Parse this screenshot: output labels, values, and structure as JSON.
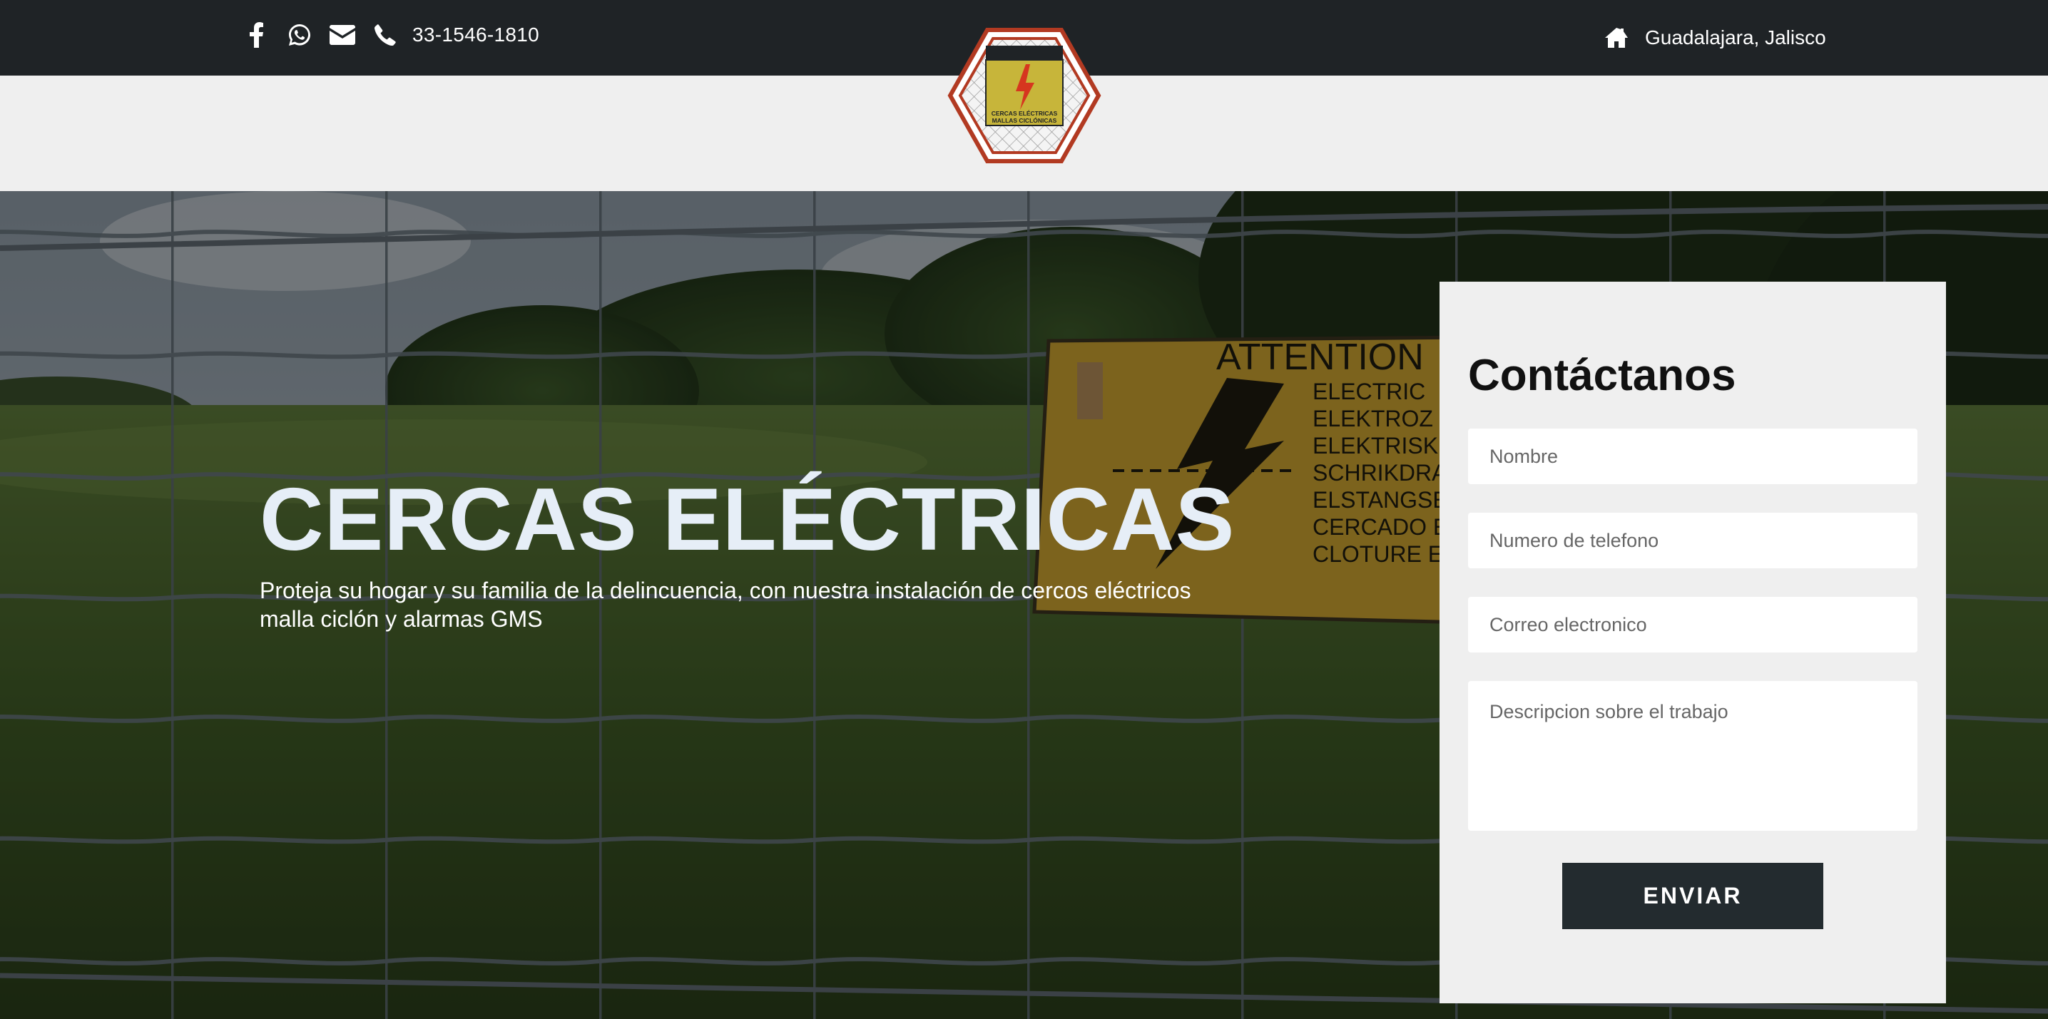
{
  "topbar": {
    "icons": [
      "facebook-icon",
      "whatsapp-icon",
      "envelope-icon",
      "phone-icon"
    ],
    "phone": "33-1546-1810",
    "location_icon": "home-icon",
    "location": "Guadalajara, Jalisco"
  },
  "logo": {
    "line1": "CERCAS ELÉCTRICAS",
    "line2": "MALLAS CICLÓNICAS"
  },
  "hero": {
    "title": "CERCAS ELÉCTRICAS",
    "subtitle": "Proteja su hogar y su familia de la delincuencia, con nuestra instalación de cercos eléctricos malla ciclón y alarmas GMS",
    "sign_heading": "ATTENTION",
    "sign_lines": [
      "ELECTRIC",
      "ELEKTROZ",
      "ELEKTRISK",
      "SCHRIKDRA",
      "ELSTANGSE",
      "CERCADO E",
      "CLOTURE E"
    ]
  },
  "contact": {
    "title": "Contáctanos",
    "name_placeholder": "Nombre",
    "phone_placeholder": "Numero de telefono",
    "email_placeholder": "Correo electronico",
    "description_placeholder": "Descripcion sobre el trabajo",
    "send_label": "ENVIAR"
  },
  "colors": {
    "topbar": "#1f2326",
    "header_band": "#efefef",
    "button": "#232b2f",
    "logo_red": "#b23a22",
    "logo_yellow": "#c7b53a"
  }
}
